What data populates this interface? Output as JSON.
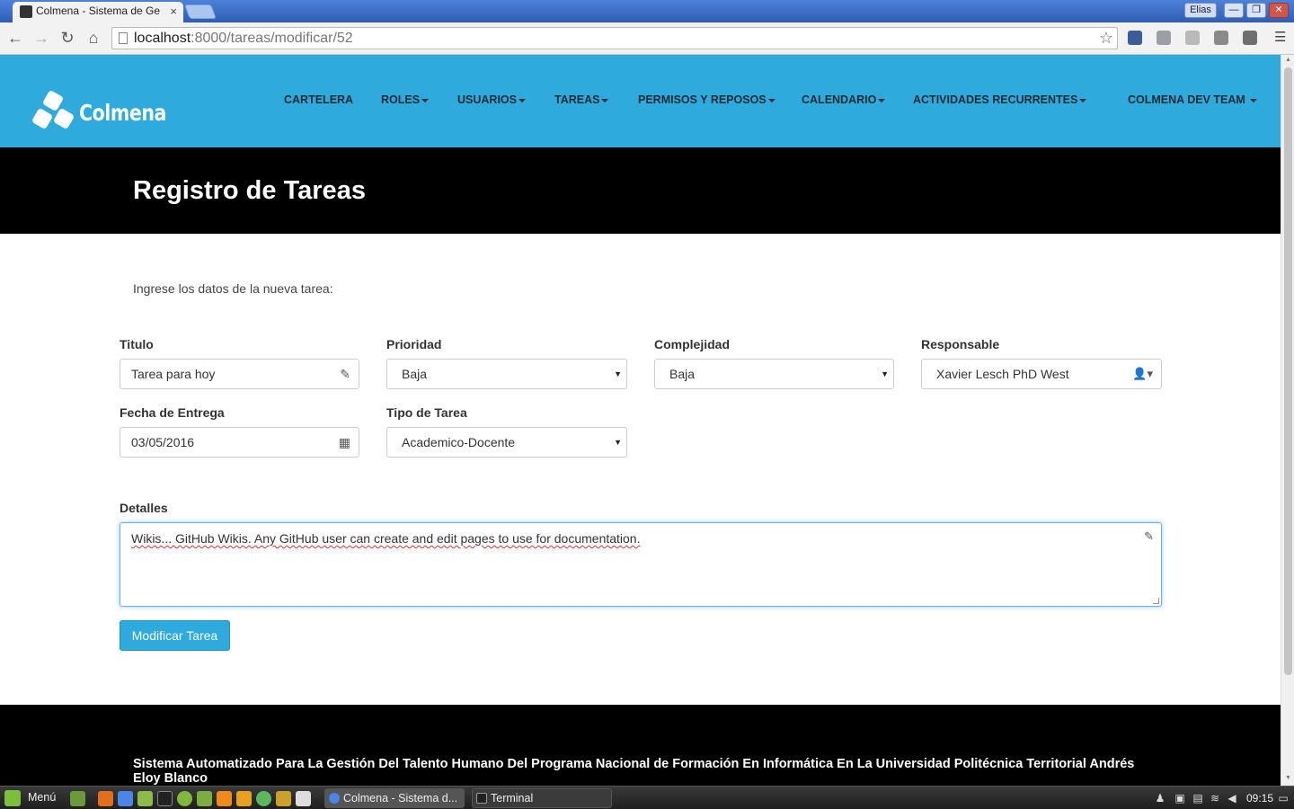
{
  "browser": {
    "tab_title": "Colmena - Sistema de Ge",
    "tab_close": "×",
    "user_badge": "Elias",
    "win_min": "—",
    "win_max": "❐",
    "win_close": "✕",
    "url_host": "localhost",
    "url_path": ":8000/tareas/modificar/52"
  },
  "navbar": {
    "brand": "Colmena",
    "menu": [
      "CARTELERA",
      "ROLES",
      "USUARIOS",
      "TAREAS",
      "PERMISOS Y REPOSOS",
      "CALENDARIO",
      "ACTIVIDADES RECURRENTES",
      "COLMENA DEV TEAM"
    ]
  },
  "header": {
    "title": "Registro de Tareas"
  },
  "form": {
    "intro": "Ingrese los datos de la nueva tarea:",
    "titulo": {
      "label": "Titulo",
      "value": "Tarea para hoy",
      "icon": "pencil-icon"
    },
    "prioridad": {
      "label": "Prioridad",
      "value": "Baja"
    },
    "complejidad": {
      "label": "Complejidad",
      "value": "Baja"
    },
    "responsable": {
      "label": "Responsable",
      "value": "Xavier Lesch PhD West",
      "icon": "user-dropdown-icon"
    },
    "fecha": {
      "label": "Fecha de Entrega",
      "value": "03/05/2016",
      "icon": "calendar-icon"
    },
    "tipo": {
      "label": "Tipo de Tarea",
      "value": "Academico-Docente"
    },
    "detalles": {
      "label": "Detalles",
      "value": "Wikis... GitHub Wikis. Any GitHub user can create and edit pages to use for documentation.",
      "icon": "edit-icon"
    },
    "submit_label": "Modificar Tarea"
  },
  "footer": {
    "text": "Sistema Automatizado Para La Gestión Del Talento Humano Del Programa Nacional de Formación En Informática En La Universidad Politécnica Territorial Andrés Eloy Blanco"
  },
  "taskbar": {
    "menu_label": "Menú",
    "windows": [
      "Colmena - Sistema d...",
      "Terminal"
    ],
    "clock": "09:15"
  },
  "colors": {
    "accent": "#2eaadc",
    "header_bg": "#000000",
    "focus_border": "#66afe9"
  }
}
